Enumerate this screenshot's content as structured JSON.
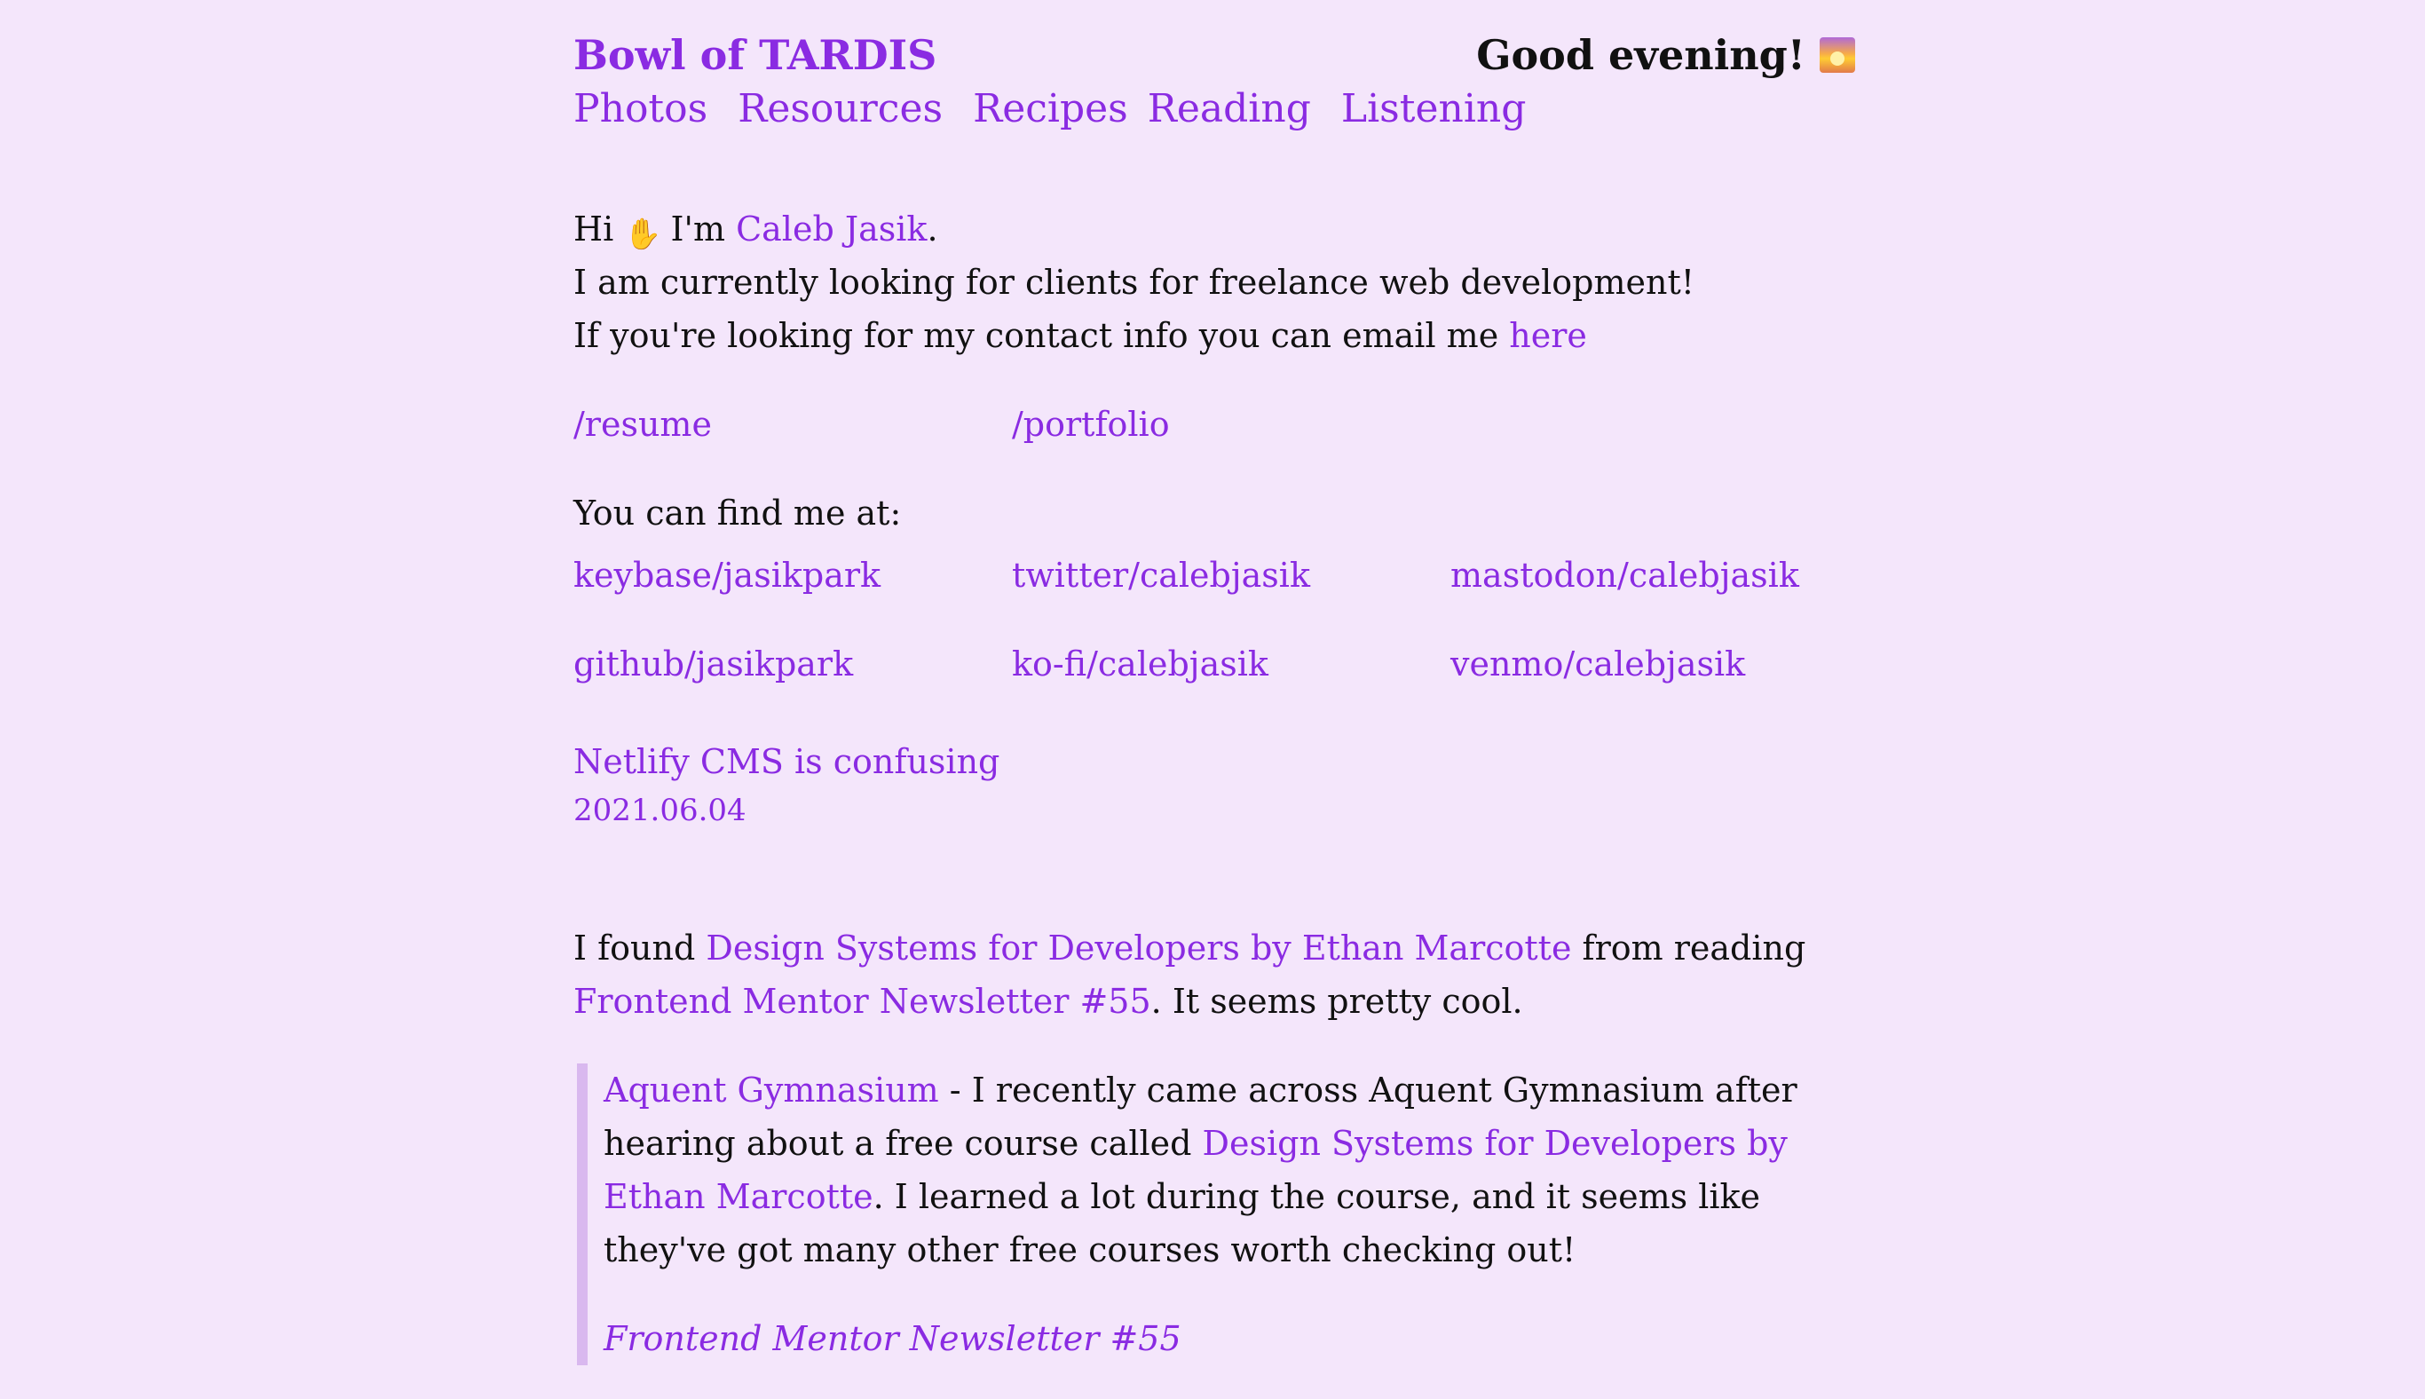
{
  "header": {
    "site_title": "Bowl of TARDIS",
    "greeting": "Good evening!",
    "greeting_icon": "sunset-icon"
  },
  "nav": [
    "Photos",
    "Resources",
    "Recipes",
    "Reading",
    "Listening"
  ],
  "intro": {
    "hi": "Hi",
    "wave_icon": "waving-hand-icon",
    "im": "I'm",
    "name": "Caleb Jasik",
    "period": ".",
    "freelance": "I am currently looking for clients for freelance web development!",
    "contact_prefix": "If you're looking for my contact info you can email me",
    "contact_link": "here"
  },
  "pages": {
    "resume": "/resume",
    "portfolio": "/portfolio"
  },
  "find_me": {
    "label": "You can find me at:",
    "links": [
      "keybase/jasikpark",
      "twitter/calebjasik",
      "mastodon/calebjasik",
      "github/jasikpark",
      "ko-fi/calebjasik",
      "venmo/calebjasik"
    ]
  },
  "latest_post": {
    "title": "Netlify CMS is confusing",
    "date": "2021.06.04"
  },
  "post": {
    "p1_prefix": "I found",
    "p1_link1": "Design Systems for Developers by Ethan Marcotte",
    "p1_middle": "from reading",
    "p1_link2": "Frontend Mentor Newsletter #55",
    "p1_suffix": ". It seems pretty cool.",
    "quote_link1": "Aquent Gymnasium",
    "quote_text1": " - I recently came across Aquent Gymnasium after hearing about a free course called ",
    "quote_link2": "Design Systems for Developers by Ethan Marcotte",
    "quote_text2": ". I learned a lot during the course, and it seems like they've got many other free courses worth checking out!",
    "quote_citation": "Frontend Mentor Newsletter #55"
  },
  "colors": {
    "background": "#f4e6fb",
    "link": "#8a2be2",
    "text": "#111111",
    "quote_border": "#d9b8ef"
  }
}
